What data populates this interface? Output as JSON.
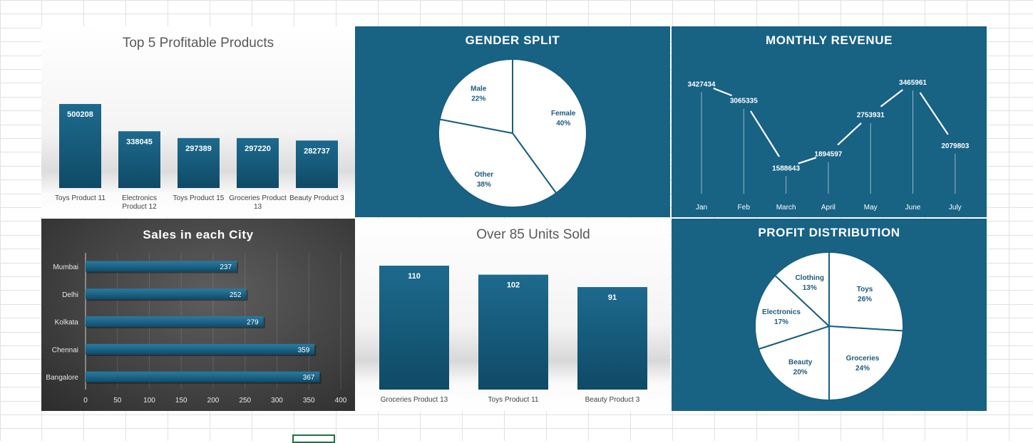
{
  "colors": {
    "teal": "#185f80",
    "teal_dark": "#0f4a66",
    "panel_teal": "#186284",
    "dark_panel": "#3a3a3a",
    "label_dark": "#1d5b7a",
    "gridline": "#e1e1e1",
    "selection": "#1e7145"
  },
  "chart_data": [
    {
      "id": "top5",
      "type": "bar",
      "title": "Top 5 Profitable Products",
      "categories": [
        "Toys Product 11",
        "Electronics Product 12",
        "Toys Product 15",
        "Groceries Product 13",
        "Beauty Product 3"
      ],
      "category_lines": [
        [
          "Toys Product 11"
        ],
        [
          "Electronics",
          "Product 12"
        ],
        [
          "Toys Product 15"
        ],
        [
          "Groceries Product",
          "13"
        ],
        [
          "Beauty Product 3"
        ]
      ],
      "values": [
        500208,
        338045,
        297389,
        297220,
        282737
      ],
      "value_labels": [
        "500208",
        "338045",
        "297389",
        "297220",
        "282737"
      ],
      "ylim": [
        0,
        520000
      ],
      "grid": false,
      "legend": "none"
    },
    {
      "id": "gender",
      "type": "pie",
      "title": "GENDER SPLIT",
      "labels": [
        "Female",
        "Other",
        "Male"
      ],
      "values": [
        40,
        38,
        22
      ],
      "percent_labels": [
        "40%",
        "38%",
        "22%"
      ],
      "legend": "none"
    },
    {
      "id": "monthly",
      "type": "line",
      "title": "MONTHLY REVENUE",
      "categories": [
        "Jan",
        "Feb",
        "March",
        "April",
        "May",
        "June",
        "July"
      ],
      "values": [
        3427434,
        3065335,
        1588643,
        1894597,
        2753931,
        3465961,
        2079803
      ],
      "value_labels": [
        "3427434",
        "3065335",
        "1588643",
        "1894597",
        "2753931",
        "3465961",
        "2079803"
      ],
      "ylim": [
        0,
        4200000
      ],
      "grid": false,
      "legend": "none"
    },
    {
      "id": "city",
      "type": "bar",
      "orientation": "horizontal",
      "title": "Sales in each City",
      "categories": [
        "Mumbai",
        "Delhi",
        "Kolkata",
        "Chennai",
        "Bangalore"
      ],
      "values": [
        237,
        252,
        279,
        359,
        367
      ],
      "value_labels": [
        "237",
        "252",
        "279",
        "359",
        "367"
      ],
      "xticks": [
        "0",
        "50",
        "100",
        "150",
        "200",
        "250",
        "300",
        "350",
        "400"
      ],
      "xlim": [
        0,
        400
      ],
      "grid": true,
      "legend": "none"
    },
    {
      "id": "units",
      "type": "bar",
      "title": "Over 85 Units Sold",
      "categories": [
        "Groceries Product 13",
        "Toys Product 11",
        "Beauty Product 3"
      ],
      "values": [
        110,
        102,
        91
      ],
      "value_labels": [
        "110",
        "102",
        "91"
      ],
      "ylim": [
        0,
        112
      ],
      "grid": false,
      "legend": "none"
    },
    {
      "id": "profit",
      "type": "pie",
      "title": "PROFIT DISTRIBUTION",
      "labels": [
        "Toys",
        "Groceries",
        "Beauty",
        "Electronics",
        "Clothing"
      ],
      "values": [
        26,
        24,
        20,
        17,
        13
      ],
      "percent_labels": [
        "26%",
        "24%",
        "20%",
        "17%",
        "13%"
      ],
      "legend": "none"
    }
  ]
}
